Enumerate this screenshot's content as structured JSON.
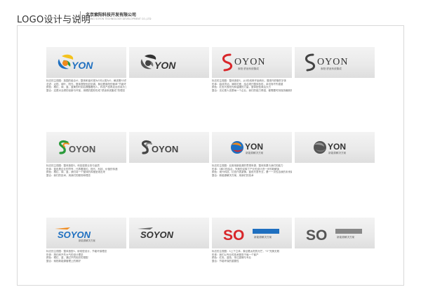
{
  "header": {
    "title": "LOGO设计与说明",
    "company": "北京索阳科技开发有限公司",
    "company_sub": "BEIJING SOYON TECHNOLOGY DEVELOPMENT CO.,LTD"
  },
  "logos": [
    {
      "wordmark": "YON",
      "tagline": "",
      "lines": [
        "标志的主视图：英国的组合VI，整体和谐可视为S可以视为O，阐述着SO的紧张环保概念",
        "总述：太阳、绿叶、阳光，整体搭配色彩协调，象征着索阳的使命“节能环保”",
        "颜色：橘红、绿、蓝、蓝黄的时到后擦醒着阳人，科技产品再走远仿真为了让人类生活更美好",
        "整合：这是对业绩的创新与环保，用橘的图形形成“舒适系统集成”的理念"
      ]
    },
    {
      "wordmark": "YON",
      "tagline": "",
      "lines": [
        ""
      ]
    },
    {
      "wordmark": "OYON",
      "tagline": "索阳·舒适系统集成",
      "lines": [
        "标志的主视图：整体造型S，从S形线条开始转化，展现作舒服的字体",
        "形体：曲线灵动，清新可爱，结合现代整体色彩，亲切而不失稳重",
        "颜色：红色代表阳光和温暖的力量，整体配色简洁大方",
        "整合：无论是人还是每一个企业，我们的能力再强，都需要时刻保持最新的状态"
      ]
    },
    {
      "wordmark": "OYON",
      "tagline": "索阳·舒适系统集成",
      "lines": [
        ""
      ]
    },
    {
      "wordmark": "OYON",
      "tagline": "",
      "lines": [
        "标志的主视图：整体造型S，科技感类业务与品质",
        "形体：蓝色是企业的符号，代表着简约、现代、科技、价值的传递",
        "颜色：橘红、绿、蓝，我们将一个整体的风格呈现出来",
        "整合：我们的技术，用我们的服务和理念"
      ]
    },
    {
      "wordmark": "OYON",
      "tagline": "",
      "lines": [
        ""
      ]
    },
    {
      "wordmark": "YON",
      "tagline": "新能源解决方案",
      "lines": [
        "标志的主视图：后常用新能源的思想来源，整体效果与我们的能力",
        "形体：S和O的结合，完美的诠释了产业的设计进一步的新解读",
        "颜色：现代科技，红色代表激情，蓝色代表专业，第一一次性自我的未来新方向",
        "整合：新能源解决方案，用我们的技术"
      ]
    },
    {
      "wordmark": "YON",
      "tagline": "新能源解决方案",
      "lines": [
        ""
      ]
    },
    {
      "wordmark": "SOYON",
      "tagline": "新能源解决方案",
      "lines": [
        "标志的主视图：整体造型S，射线型设计，节能环保理念",
        "形体：简约而不失大气的设计理念",
        "颜色：橘红、蓝，通过不同色彩的搭配",
        "整合：索阳新能源管理上的美好"
      ]
    },
    {
      "wordmark": "SOYON",
      "tagline": "",
      "lines": [
        ""
      ]
    },
    {
      "wordmark": "SO",
      "tagline": "新能源解决方案",
      "lines": [
        "标志的主视图：S上下立体，象征着太阳的光芒，“O”完美无瑕",
        "形体：我们以专业的技术服务于每一个客户",
        "颜色：红色、蓝色，传达激情与专业",
        "整合：节能环保的重要性"
      ]
    },
    {
      "wordmark": "SO",
      "tagline": "新能源解决方案",
      "lines": [
        ""
      ]
    }
  ],
  "colors": {
    "orange": "#f08a1c",
    "blue": "#1e6fc0",
    "red": "#d8262a",
    "green": "#2a9a3a",
    "gray": "#4a4a4a"
  }
}
